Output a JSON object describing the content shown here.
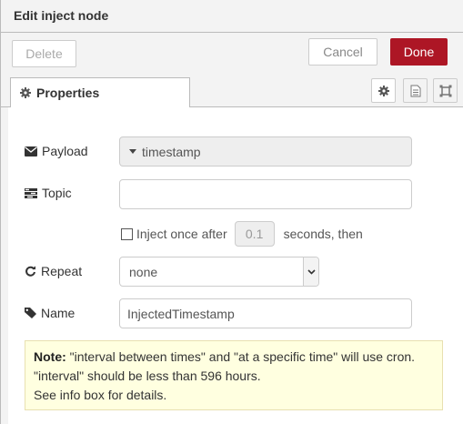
{
  "header": {
    "title": "Edit inject node"
  },
  "toolbar": {
    "delete_label": "Delete",
    "cancel_label": "Cancel",
    "done_label": "Done"
  },
  "tabs": {
    "properties_label": "Properties",
    "icons": [
      "gear-icon",
      "document-icon",
      "frame-icon"
    ]
  },
  "form": {
    "payload": {
      "label": "Payload",
      "value": "timestamp"
    },
    "topic": {
      "label": "Topic",
      "value": ""
    },
    "inject_once": {
      "label": "Inject once after",
      "checked": false,
      "value": "0.1",
      "suffix": "seconds, then"
    },
    "repeat": {
      "label": "Repeat",
      "value": "none"
    },
    "name": {
      "label": "Name",
      "value": "InjectedTimestamp"
    }
  },
  "note": {
    "bold": "Note:",
    "line1": " \"interval between times\" and \"at a specific time\" will use cron.",
    "line2": "\"interval\" should be less than 596 hours.",
    "line3": "See info box for details."
  },
  "colors": {
    "done_button": "#ad1625",
    "note_background": "#ffffe0"
  }
}
